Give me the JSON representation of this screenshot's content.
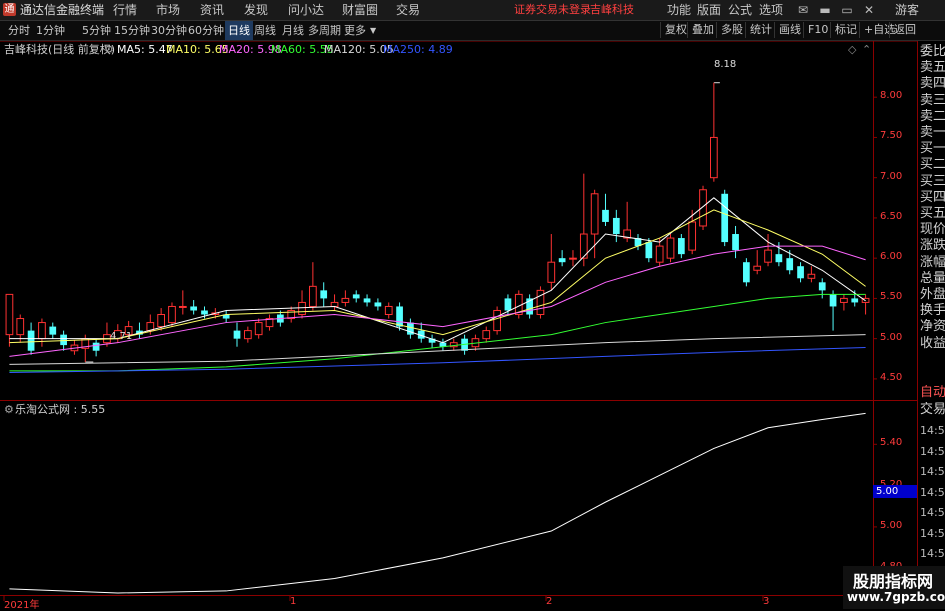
{
  "window": {
    "app_title": "通达信金融终端",
    "menu": [
      "行情",
      "市场",
      "资讯",
      "发现",
      "问小达",
      "财富圈",
      "交易"
    ],
    "login_status": "证券交易未登录",
    "stock_name_title": "吉峰科技",
    "right_menu": [
      "功能",
      "版面",
      "公式",
      "选项"
    ],
    "guest": "游客"
  },
  "toolbar": {
    "periods": [
      "分时",
      "1分钟",
      "5分钟",
      "15分钟",
      "30分钟",
      "60分钟",
      "日线",
      "周线",
      "月线",
      "多周期",
      "更多"
    ],
    "active_period": "日线",
    "right_buttons": [
      "复权",
      "叠加",
      "多股",
      "统计",
      "画线",
      "F10",
      "标记",
      "+自选",
      "返回"
    ]
  },
  "main_chart": {
    "stock_label": "吉峰科技(日线 前复权)",
    "ma_legend": [
      {
        "label": "MA5: 5.47",
        "color": "#ffffff"
      },
      {
        "label": "MA10: 5.65",
        "color": "#ffff66"
      },
      {
        "label": "MA20: 5.98",
        "color": "#ff66ff"
      },
      {
        "label": "MA60: 5.55",
        "color": "#33ff33"
      },
      {
        "label": "MA120: 5.05",
        "color": "#d9d9d9"
      },
      {
        "label": "MA250: 4.89",
        "color": "#3355ff"
      }
    ],
    "high_label": "8.18",
    "low_label": "4.71",
    "y_ticks": [
      "8.00",
      "7.50",
      "7.00",
      "6.50",
      "6.00",
      "5.50",
      "5.00",
      "4.50"
    ]
  },
  "sub_chart": {
    "indicator_label": "乐淘公式网 : 5.55",
    "y_ticks": [
      "5.40",
      "5.20",
      "5.00",
      "4.80"
    ],
    "current_value": "5.00"
  },
  "x_axis": {
    "labels": [
      "2021年",
      "1",
      "2",
      "3"
    ]
  },
  "right_panel": {
    "order_book": [
      "委比",
      "卖五",
      "卖四",
      "卖三",
      "卖二",
      "卖一",
      "买一",
      "买二",
      "买三",
      "买四",
      "买五",
      "现价",
      "涨跌",
      "涨幅",
      "总量",
      "外盘",
      "换手",
      "净资",
      "收益"
    ],
    "tabs": [
      "自动",
      "交易"
    ],
    "ticks": [
      "14:56",
      "14:56",
      "14:56",
      "14:56",
      "14:56",
      "14:56",
      "14:56",
      "14:56",
      "14:56"
    ]
  },
  "watermark": {
    "line1": "股朋指标网",
    "line2": "www.7gpzb.com"
  },
  "chart_data": {
    "type": "candlestick",
    "title": "吉峰科技(日线 前复权)",
    "ylim": [
      4.3,
      8.4
    ],
    "sub_ylim": [
      4.68,
      5.6
    ],
    "candles": [
      [
        5.05,
        5.55,
        5.55,
        4.9
      ],
      [
        5.05,
        5.25,
        5.3,
        4.95
      ],
      [
        5.1,
        4.85,
        5.2,
        4.8
      ],
      [
        5.0,
        5.2,
        5.25,
        4.9
      ],
      [
        5.15,
        5.05,
        5.2,
        5.0
      ],
      [
        5.05,
        4.92,
        5.1,
        4.85
      ],
      [
        4.85,
        4.92,
        4.98,
        4.8
      ],
      [
        4.88,
        5.0,
        5.05,
        4.71
      ],
      [
        4.95,
        4.85,
        5.0,
        4.78
      ],
      [
        4.95,
        5.05,
        5.2,
        4.9
      ],
      [
        5.0,
        5.1,
        5.18,
        4.95
      ],
      [
        5.05,
        5.15,
        5.22,
        5.0
      ],
      [
        5.1,
        5.05,
        5.2,
        5.0
      ],
      [
        5.1,
        5.2,
        5.3,
        5.05
      ],
      [
        5.15,
        5.3,
        5.38,
        5.1
      ],
      [
        5.2,
        5.4,
        5.45,
        5.15
      ],
      [
        5.4,
        5.4,
        5.6,
        5.3
      ],
      [
        5.4,
        5.35,
        5.48,
        5.3
      ],
      [
        5.35,
        5.3,
        5.4,
        5.25
      ],
      [
        5.3,
        5.32,
        5.38,
        5.25
      ],
      [
        5.3,
        5.25,
        5.35,
        5.2
      ],
      [
        5.1,
        5.0,
        5.2,
        4.9
      ],
      [
        5.0,
        5.1,
        5.15,
        4.95
      ],
      [
        5.05,
        5.2,
        5.25,
        5.0
      ],
      [
        5.15,
        5.25,
        5.3,
        5.1
      ],
      [
        5.3,
        5.2,
        5.35,
        5.15
      ],
      [
        5.25,
        5.35,
        5.4,
        5.2
      ],
      [
        5.3,
        5.45,
        5.6,
        5.25
      ],
      [
        5.4,
        5.65,
        5.95,
        5.35
      ],
      [
        5.6,
        5.5,
        5.7,
        5.4
      ],
      [
        5.4,
        5.45,
        5.55,
        5.35
      ],
      [
        5.45,
        5.5,
        5.6,
        5.4
      ],
      [
        5.55,
        5.5,
        5.6,
        5.45
      ],
      [
        5.5,
        5.45,
        5.55,
        5.4
      ],
      [
        5.45,
        5.4,
        5.5,
        5.35
      ],
      [
        5.3,
        5.4,
        5.45,
        5.25
      ],
      [
        5.4,
        5.15,
        5.45,
        5.1
      ],
      [
        5.2,
        5.05,
        5.25,
        5.0
      ],
      [
        5.1,
        5.0,
        5.2,
        4.95
      ],
      [
        5.0,
        4.95,
        5.05,
        4.88
      ],
      [
        4.95,
        4.9,
        5.0,
        4.85
      ],
      [
        4.9,
        4.95,
        5.0,
        4.85
      ],
      [
        5.0,
        4.85,
        5.05,
        4.8
      ],
      [
        4.9,
        5.0,
        5.05,
        4.85
      ],
      [
        5.0,
        5.1,
        5.15,
        4.95
      ],
      [
        5.1,
        5.35,
        5.4,
        5.05
      ],
      [
        5.5,
        5.35,
        5.55,
        5.3
      ],
      [
        5.3,
        5.55,
        5.6,
        5.25
      ],
      [
        5.5,
        5.3,
        5.55,
        5.25
      ],
      [
        5.3,
        5.6,
        5.65,
        5.25
      ],
      [
        5.7,
        5.95,
        6.3,
        5.6
      ],
      [
        6.0,
        5.95,
        6.1,
        5.9
      ],
      [
        6.0,
        6.0,
        6.1,
        5.9
      ],
      [
        6.0,
        6.3,
        7.05,
        5.9
      ],
      [
        6.3,
        6.8,
        6.85,
        6.0
      ],
      [
        6.6,
        6.45,
        6.8,
        6.4
      ],
      [
        6.5,
        6.3,
        6.6,
        6.2
      ],
      [
        6.25,
        6.35,
        6.7,
        6.2
      ],
      [
        6.25,
        6.15,
        6.3,
        6.1
      ],
      [
        6.2,
        6.0,
        6.25,
        5.95
      ],
      [
        5.95,
        6.15,
        6.25,
        5.9
      ],
      [
        6.0,
        6.25,
        6.3,
        5.95
      ],
      [
        6.25,
        6.05,
        6.3,
        6.0
      ],
      [
        6.1,
        6.45,
        6.6,
        6.05
      ],
      [
        6.4,
        6.85,
        6.9,
        6.35
      ],
      [
        7.0,
        7.5,
        8.18,
        6.95
      ],
      [
        6.8,
        6.2,
        6.85,
        6.15
      ],
      [
        6.3,
        6.1,
        6.4,
        6.0
      ],
      [
        5.95,
        5.7,
        6.0,
        5.65
      ],
      [
        5.85,
        5.9,
        6.1,
        5.8
      ],
      [
        5.95,
        6.1,
        6.3,
        5.9
      ],
      [
        6.05,
        5.95,
        6.2,
        5.9
      ],
      [
        6.0,
        5.85,
        6.1,
        5.8
      ],
      [
        5.9,
        5.75,
        5.95,
        5.7
      ],
      [
        5.75,
        5.8,
        5.9,
        5.7
      ],
      [
        5.7,
        5.6,
        5.75,
        5.5
      ],
      [
        5.55,
        5.4,
        5.6,
        5.1
      ],
      [
        5.45,
        5.5,
        5.55,
        5.35
      ],
      [
        5.5,
        5.45,
        5.6,
        5.4
      ],
      [
        5.45,
        5.5,
        5.55,
        5.3
      ]
    ],
    "ma": {
      "MA5": {
        "color": "#ffffff",
        "points": [
          [
            0,
            5.0
          ],
          [
            10,
            5.0
          ],
          [
            20,
            5.35
          ],
          [
            30,
            5.4
          ],
          [
            40,
            4.95
          ],
          [
            50,
            5.6
          ],
          [
            55,
            6.3
          ],
          [
            60,
            6.2
          ],
          [
            65,
            6.75
          ],
          [
            70,
            6.2
          ],
          [
            75,
            5.85
          ],
          [
            79,
            5.47
          ]
        ]
      },
      "MA10": {
        "color": "#ffff66",
        "points": [
          [
            0,
            4.95
          ],
          [
            10,
            5.0
          ],
          [
            20,
            5.3
          ],
          [
            30,
            5.35
          ],
          [
            40,
            5.05
          ],
          [
            50,
            5.45
          ],
          [
            55,
            6.0
          ],
          [
            60,
            6.25
          ],
          [
            65,
            6.6
          ],
          [
            70,
            6.35
          ],
          [
            75,
            6.05
          ],
          [
            79,
            5.65
          ]
        ]
      },
      "MA20": {
        "color": "#ff66ff",
        "points": [
          [
            0,
            4.78
          ],
          [
            10,
            4.95
          ],
          [
            20,
            5.2
          ],
          [
            30,
            5.3
          ],
          [
            40,
            5.15
          ],
          [
            50,
            5.4
          ],
          [
            55,
            5.7
          ],
          [
            60,
            5.9
          ],
          [
            65,
            6.05
          ],
          [
            70,
            6.15
          ],
          [
            75,
            6.15
          ],
          [
            79,
            5.98
          ]
        ]
      },
      "MA60": {
        "color": "#33ff33",
        "points": [
          [
            0,
            4.6
          ],
          [
            10,
            4.6
          ],
          [
            20,
            4.65
          ],
          [
            30,
            4.75
          ],
          [
            40,
            4.9
          ],
          [
            50,
            5.05
          ],
          [
            55,
            5.2
          ],
          [
            60,
            5.3
          ],
          [
            65,
            5.4
          ],
          [
            70,
            5.5
          ],
          [
            75,
            5.55
          ],
          [
            79,
            5.55
          ]
        ]
      },
      "MA120": {
        "color": "#d9d9d9",
        "points": [
          [
            0,
            4.68
          ],
          [
            20,
            4.72
          ],
          [
            40,
            4.85
          ],
          [
            55,
            4.95
          ],
          [
            65,
            5.0
          ],
          [
            79,
            5.05
          ]
        ]
      },
      "MA250": {
        "color": "#3355ff",
        "points": [
          [
            0,
            4.58
          ],
          [
            20,
            4.62
          ],
          [
            40,
            4.7
          ],
          [
            55,
            4.78
          ],
          [
            65,
            4.83
          ],
          [
            79,
            4.89
          ]
        ]
      }
    },
    "indicator": {
      "name": "乐淘公式网",
      "color": "#ffffff",
      "points": [
        [
          0,
          4.7
        ],
        [
          10,
          4.68
        ],
        [
          20,
          4.69
        ],
        [
          30,
          4.75
        ],
        [
          40,
          4.85
        ],
        [
          50,
          4.98
        ],
        [
          55,
          5.12
        ],
        [
          60,
          5.25
        ],
        [
          65,
          5.38
        ],
        [
          70,
          5.48
        ],
        [
          75,
          5.52
        ],
        [
          79,
          5.55
        ]
      ]
    }
  }
}
